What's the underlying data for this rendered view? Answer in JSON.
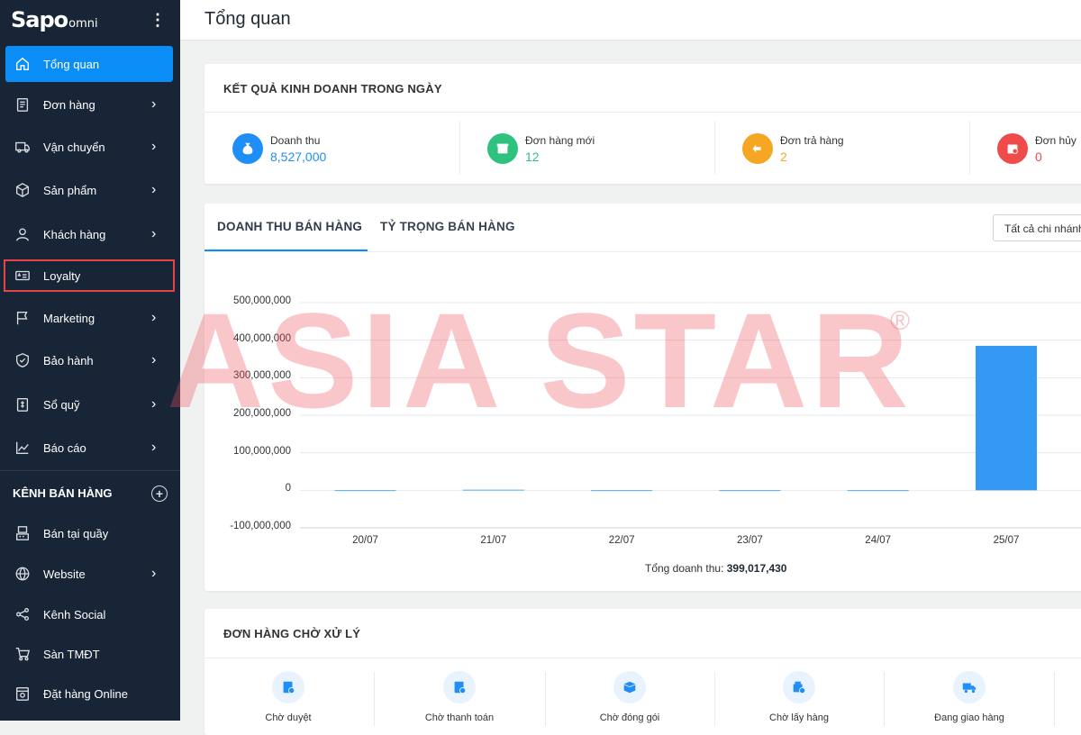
{
  "app": {
    "logo": "Sapo",
    "logo_suffix": "omni"
  },
  "header": {
    "title": "Tổng quan"
  },
  "sidebar": {
    "items": [
      {
        "label": "Tổng quan",
        "icon": "home-icon",
        "active": true,
        "chevron": false
      },
      {
        "label": "Đơn hàng",
        "icon": "orders-icon",
        "chevron": true
      },
      {
        "label": "Vận chuyển",
        "icon": "truck-icon",
        "chevron": true
      },
      {
        "label": "Sản phẩm",
        "icon": "box-icon",
        "chevron": true
      },
      {
        "label": "Khách hàng",
        "icon": "user-icon",
        "chevron": true
      },
      {
        "label": "Loyalty",
        "icon": "loyalty-card-icon",
        "chevron": false,
        "highlighted": true
      },
      {
        "label": "Marketing",
        "icon": "flag-icon",
        "chevron": true
      },
      {
        "label": "Bảo hành",
        "icon": "shield-icon",
        "chevron": true
      },
      {
        "label": "Sổ quỹ",
        "icon": "cashbook-icon",
        "chevron": true
      },
      {
        "label": "Báo cáo",
        "icon": "chart-icon",
        "chevron": true
      }
    ],
    "channels_header": "KÊNH BÁN HÀNG",
    "channels": [
      {
        "label": "Bán tại quầy",
        "icon": "pos-icon",
        "chevron": false
      },
      {
        "label": "Website",
        "icon": "globe-icon",
        "chevron": true
      },
      {
        "label": "Kênh Social",
        "icon": "share-icon",
        "chevron": false
      },
      {
        "label": "Sàn TMĐT",
        "icon": "cart-icon",
        "chevron": false
      },
      {
        "label": "Đặt hàng Online",
        "icon": "online-order-icon",
        "chevron": false
      }
    ]
  },
  "business": {
    "title": "KẾT QUẢ KINH DOANH TRONG NGÀY",
    "kpis": [
      {
        "label": "Doanh thu",
        "value": "8,527,000",
        "color": "#1f8ff7",
        "icon": "money-bag-icon"
      },
      {
        "label": "Đơn hàng mới",
        "value": "12",
        "color": "#2ec27e",
        "icon": "new-order-icon"
      },
      {
        "label": "Đơn trả hàng",
        "value": "2",
        "color": "#f5a623",
        "icon": "return-order-icon"
      },
      {
        "label": "Đơn hủy",
        "value": "0",
        "color": "#ef4b4b",
        "icon": "cancel-order-icon"
      }
    ]
  },
  "sales": {
    "tabs": [
      "DOANH THU BÁN HÀNG",
      "TỶ TRỌNG BÁN HÀNG"
    ],
    "branch_select": "Tất cả chi nhánh",
    "total_label": "Tổng doanh thu:",
    "total_value": "399,017,430"
  },
  "chart_data": {
    "type": "bar",
    "categories": [
      "20/07",
      "21/07",
      "22/07",
      "23/07",
      "24/07",
      "25/07"
    ],
    "values": [
      0,
      1500000,
      0,
      0,
      0,
      385000000
    ],
    "yticks": [
      "500,000,000",
      "400,000,000",
      "300,000,000",
      "200,000,000",
      "100,000,000",
      "0",
      "-100,000,000"
    ],
    "ylim": [
      -100000000,
      500000000
    ],
    "bar_color": "#3399f3",
    "grid": true
  },
  "pending": {
    "title": "ĐƠN HÀNG CHỜ XỬ LÝ",
    "items": [
      {
        "label": "Chờ duyệt",
        "icon": "clipboard-clock-icon"
      },
      {
        "label": "Chờ thanh toán",
        "icon": "clipboard-pay-icon"
      },
      {
        "label": "Chờ đóng gói",
        "icon": "package-icon"
      },
      {
        "label": "Chờ lấy hàng",
        "icon": "pickup-box-icon"
      },
      {
        "label": "Đang giao hàng",
        "icon": "delivery-truck-icon"
      }
    ]
  },
  "watermark": {
    "text": "ASIA STAR",
    "mark": "®"
  }
}
